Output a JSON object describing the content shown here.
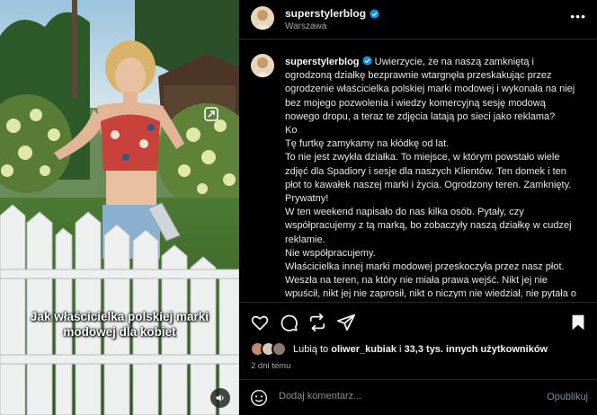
{
  "post": {
    "username": "superstylerblog",
    "location": "Warszawa",
    "overlay_caption": "Jak właścicielka polskiej marki modowej dla kobiet",
    "caption_lines": [
      "Uwierzycie, że na naszą zamkniętą i ogrodzoną działkę bezprawnie wtargnęła przeskakując przez ogrodzenie właścicielka polskiej marki modowej i wykonała na niej bez mojego pozwolenia i wiedzy komercyjną sesję modową nowego dropu, a teraz te zdjęcia latają po sieci jako reklama?",
      "Ko",
      "Tę furtkę zamykamy na kłódkę od lat.",
      "To nie jest zwykła działka. To miejsce, w którym powstało wiele zdjęć dla Spadiory i sesje dla naszych Klientów. Ten domek i ten płot to kawałek naszej marki i życia. Ogrodzony teren. Zamknięty. Prywatny!",
      "W ten weekend napisało do nas kilka osób. Pytały, czy współpracujemy z tą marką, bo zobaczyły naszą działkę w cudzej reklamie.",
      "Nie współpracujemy.",
      "Właścicielka innej marki modowej przeskoczyła przez nasz płot. Weszła na teren, na który nie miała prawa wejść. Nikt jej nie wpuścił, nikt jej nie zaprosił, nikt o niczym nie wiedział, nie pytała o zgodę. Nie tylko weszła na nasz teren, ale również położyła się"
    ],
    "likes_prefix": "Lubią to",
    "likes_user": "oliwer_kubiak",
    "likes_mid": "i",
    "likes_count": "33,3 tys. innych użytkowników",
    "time_ago": "2 dni temu",
    "comment_placeholder": "Dodaj komentarz...",
    "publish_label": "Opublikuj"
  },
  "icons": {
    "more": "more-icon",
    "verified": "verified-badge-icon",
    "like": "heart-icon",
    "comment": "comment-icon",
    "share": "share-icon",
    "send": "send-icon",
    "save": "bookmark-icon",
    "emoji": "emoji-icon",
    "sound": "speaker-icon",
    "tags": "tag-icon"
  },
  "colors": {
    "background": "#000000",
    "text": "#f5f5f5",
    "secondary": "#a8a8a8",
    "verified": "#0095f6",
    "publish": "#7a8fa6"
  }
}
